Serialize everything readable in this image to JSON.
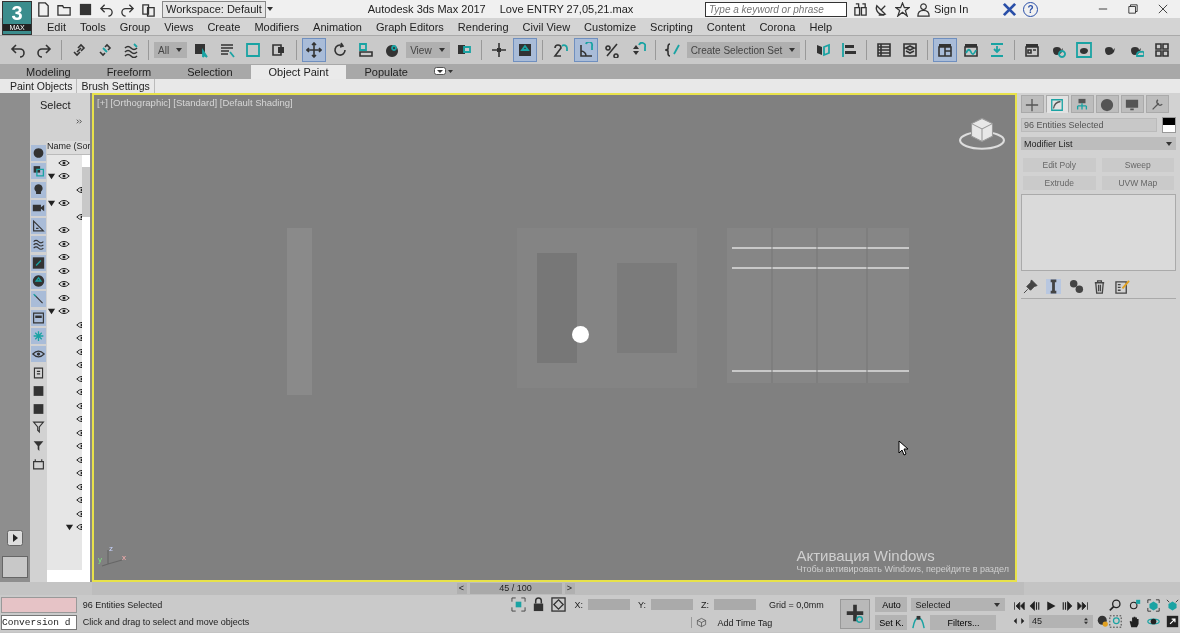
{
  "app": {
    "logo": "3",
    "logo_sub": "MAX"
  },
  "title_bar": {
    "workspace": "Workspace: Default",
    "title": "Autodesk 3ds Max 2017",
    "file": "Love  ENTRY 27,05,21.max",
    "search": {
      "placeholder": "Type a keyword or phrase"
    },
    "sign_in": "Sign In",
    "help": "?"
  },
  "menu": [
    "Edit",
    "Tools",
    "Group",
    "Views",
    "Create",
    "Modifiers",
    "Animation",
    "Graph Editors",
    "Rendering",
    "Civil View",
    "Customize",
    "Scripting",
    "Content",
    "Corona",
    "Help"
  ],
  "main_toolbar": [
    {
      "kind": "icon",
      "selected": false
    },
    {
      "kind": "icon",
      "selected": false
    },
    {
      "kind": "separator"
    },
    {
      "kind": "icon",
      "selected": false
    },
    {
      "kind": "icon",
      "selected": false
    },
    {
      "kind": "icon",
      "selected": false
    },
    {
      "kind": "separator"
    },
    {
      "kind": "dropdown",
      "value": "All"
    },
    {
      "kind": "icon",
      "selected": false
    },
    {
      "kind": "icon",
      "selected": false
    },
    {
      "kind": "icon",
      "selected": false
    },
    {
      "kind": "icon",
      "selected": false
    },
    {
      "kind": "separator"
    },
    {
      "kind": "icon",
      "selected": true
    },
    {
      "kind": "icon",
      "selected": false
    },
    {
      "kind": "icon",
      "selected": false
    },
    {
      "kind": "icon",
      "selected": false
    },
    {
      "kind": "dropdown",
      "value": "View"
    },
    {
      "kind": "icon",
      "selected": false
    },
    {
      "kind": "separator"
    },
    {
      "kind": "icon",
      "selected": false
    },
    {
      "kind": "icon",
      "selected": true
    },
    {
      "kind": "separator"
    },
    {
      "kind": "icon",
      "selected": false
    },
    {
      "kind": "icon",
      "selected": true
    },
    {
      "kind": "icon",
      "selected": false
    },
    {
      "kind": "icon",
      "selected": false
    },
    {
      "kind": "separator"
    },
    {
      "kind": "icon",
      "selected": false
    },
    {
      "kind": "dropdown",
      "value": "Create Selection Set"
    },
    {
      "kind": "separator"
    },
    {
      "kind": "icon",
      "selected": false
    },
    {
      "kind": "icon",
      "selected": false
    },
    {
      "kind": "separator"
    },
    {
      "kind": "icon",
      "selected": false
    },
    {
      "kind": "icon",
      "selected": false
    },
    {
      "kind": "separator"
    },
    {
      "kind": "icon",
      "selected": true
    },
    {
      "kind": "icon",
      "selected": false
    },
    {
      "kind": "icon",
      "selected": false
    },
    {
      "kind": "separator"
    },
    {
      "kind": "icon",
      "selected": false
    },
    {
      "kind": "icon",
      "selected": false
    },
    {
      "kind": "icon",
      "selected": false
    },
    {
      "kind": "icon",
      "selected": false
    },
    {
      "kind": "icon",
      "selected": false
    },
    {
      "kind": "icon",
      "selected": false
    }
  ],
  "ribbon": {
    "tabs": [
      {
        "label": "Modeling",
        "selected": false
      },
      {
        "label": "Freeform",
        "selected": false
      },
      {
        "label": "Selection",
        "selected": false
      },
      {
        "label": "Object Paint",
        "selected": true
      },
      {
        "label": "Populate",
        "selected": false
      }
    ],
    "panels": [
      "Paint Objects",
      "Brush Settings"
    ]
  },
  "scene_explorer": {
    "title": "Select",
    "column": "Name (Sor",
    "filters": [
      {
        "selected": true
      },
      {
        "selected": true
      },
      {
        "selected": true
      },
      {
        "selected": true
      },
      {
        "selected": true
      },
      {
        "selected": true
      },
      {
        "selected": true
      },
      {
        "selected": true
      },
      {
        "selected": true
      },
      {
        "selected": true
      },
      {
        "selected": true
      },
      {
        "selected": true
      },
      {
        "selected": false
      },
      {
        "selected": false
      },
      {
        "selected": false
      },
      {
        "selected": false
      },
      {
        "selected": false
      },
      {
        "selected": false
      }
    ],
    "tree": [
      {
        "visible": true
      },
      {
        "visible": true,
        "expanded": true,
        "children": [
          {
            "visible": true
          }
        ]
      },
      {
        "visible": true,
        "expanded": true,
        "children": [
          {
            "visible": true
          }
        ]
      },
      {
        "visible": true
      },
      {
        "visible": true
      },
      {
        "visible": true
      },
      {
        "visible": true
      },
      {
        "visible": true
      },
      {
        "visible": true
      },
      {
        "visible": true,
        "expanded": true,
        "children": [
          {
            "visible": true
          },
          {
            "visible": true
          },
          {
            "visible": true
          },
          {
            "visible": true
          },
          {
            "visible": true
          },
          {
            "visible": true
          },
          {
            "visible": true
          },
          {
            "visible": true
          },
          {
            "visible": true
          },
          {
            "visible": true
          },
          {
            "visible": true
          },
          {
            "visible": true
          },
          {
            "visible": true
          },
          {
            "visible": true
          },
          {
            "visible": true
          },
          {
            "visible": true,
            "expanded": true
          }
        ]
      }
    ]
  },
  "viewport": {
    "label": "[+] [Orthographic] [Standard] [Default Shading]",
    "axes": [
      "y",
      "z",
      "x"
    ]
  },
  "command_panel": {
    "tabs": [
      {
        "selected": false
      },
      {
        "selected": true
      },
      {
        "selected": false
      },
      {
        "selected": false
      },
      {
        "selected": false
      },
      {
        "selected": false
      }
    ],
    "name_field": "96 Entities Selected",
    "modifier_list": "Modifier List",
    "modifier_buttons": [
      "Edit Poly",
      "Sweep",
      "Extrude",
      "UVW Map"
    ]
  },
  "timeline": {
    "prev": "<",
    "frame": "45 / 100",
    "next": ">",
    "level": 0.45
  },
  "status": {
    "listener": "Conversion d",
    "selection": "96 Entities Selected",
    "prompt": "Click and drag to select and move objects",
    "x_label": "X:",
    "y_label": "Y:",
    "z_label": "Z:",
    "grid": "Grid = 0,0mm",
    "time_tag": "Add Time Tag",
    "auto": "Auto",
    "key_filter": "Selected",
    "set_key": "Set K.",
    "filters": "Filters...",
    "frame": "45"
  },
  "os_notice": {
    "title": "Активация Windows",
    "text": "Чтобы активировать Windows, перейдите в раздел"
  }
}
